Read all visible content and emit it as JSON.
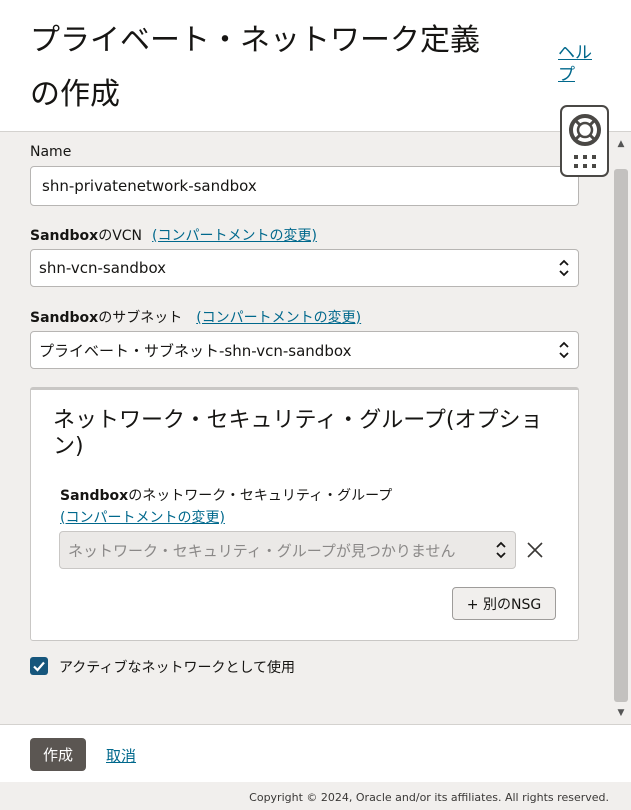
{
  "header": {
    "title_line1": "プライベート・ネットワーク定義",
    "title_line2": "の作成",
    "help_label": "ヘルプ"
  },
  "form": {
    "name": {
      "label": "Name",
      "value": "shn-privatenetwork-sandbox"
    },
    "vcn": {
      "label_bold": "Sandbox",
      "label_rest": "のVCN",
      "change_compartment": "(コンパートメントの変更)",
      "value": "shn-vcn-sandbox"
    },
    "subnet": {
      "label_bold": "Sandbox",
      "label_rest": "のサブネット",
      "change_compartment": "(コンパートメントの変更)",
      "value": "プライベート・サブネット-shn-vcn-sandbox"
    },
    "nsg": {
      "title": "ネットワーク・セキュリティ・グループ(オプション)",
      "label_bold": "Sandbox",
      "label_rest": "のネットワーク・セキュリティ・グループ",
      "change_compartment": "(コンパートメントの変更)",
      "placeholder": "ネットワーク・セキュリティ・グループが見つかりません",
      "add_button": "+ 別のNSG"
    },
    "active_checkbox": {
      "label": "アクティブなネットワークとして使用",
      "checked": true
    }
  },
  "footer": {
    "create_label": "作成",
    "cancel_label": "取消"
  },
  "copyright": "Copyright © 2024, Oracle and/or its affiliates. All rights reserved.",
  "icons": {
    "help_widget": "lifebuoy-icon",
    "apps": "grid-icon",
    "clear": "close-icon",
    "select": "chevron-updown-icon",
    "checkbox": "check-icon"
  },
  "colors": {
    "link": "#00688c",
    "primary_button": "#5b5652",
    "checkbox": "#16567c",
    "panel_background": "#f1efed"
  }
}
